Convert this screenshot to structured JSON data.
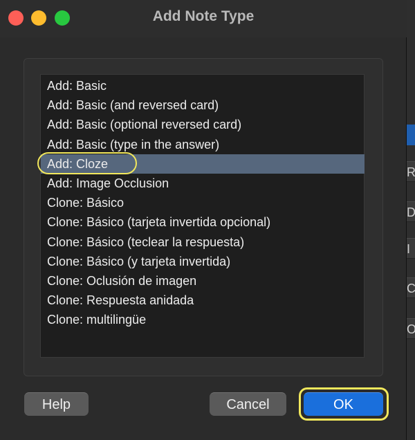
{
  "window": {
    "title": "Add Note Type"
  },
  "note_types": [
    {
      "label": "Add: Basic",
      "selected": false
    },
    {
      "label": "Add: Basic (and reversed card)",
      "selected": false
    },
    {
      "label": "Add: Basic (optional reversed card)",
      "selected": false
    },
    {
      "label": "Add: Basic (type in the answer)",
      "selected": false
    },
    {
      "label": "Add: Cloze",
      "selected": true
    },
    {
      "label": "Add: Image Occlusion",
      "selected": false
    },
    {
      "label": "Clone: Básico",
      "selected": false
    },
    {
      "label": "Clone: Básico (tarjeta invertida opcional)",
      "selected": false
    },
    {
      "label": "Clone: Básico (teclear la respuesta)",
      "selected": false
    },
    {
      "label": "Clone: Básico (y tarjeta invertida)",
      "selected": false
    },
    {
      "label": "Clone: Oclusión de imagen",
      "selected": false
    },
    {
      "label": "Clone: Respuesta anidada",
      "selected": false
    },
    {
      "label": "Clone: multilingüe",
      "selected": false
    }
  ],
  "buttons": {
    "help": "Help",
    "cancel": "Cancel",
    "ok": "OK"
  },
  "background_window": {
    "letters": [
      "R",
      "D",
      "I",
      "C",
      "O"
    ]
  },
  "colors": {
    "selection": "#56677d",
    "annotation_ring": "#f2e85c",
    "ok_button": "#1a6fdc"
  }
}
